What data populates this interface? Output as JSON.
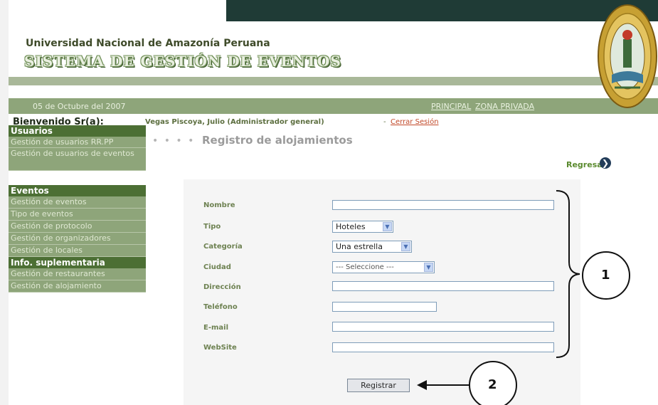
{
  "header": {
    "university": "Universidad Nacional de Amazonía Peruana",
    "system_title": "SISTEMA DE GESTIÓN DE EVENTOS",
    "date": "05 de Octubre del 2007",
    "nav_principal": "PRINCIPAL",
    "nav_private": "ZONA PRIVADA"
  },
  "welcome": {
    "greeting": "Bienvenido Sr(a):",
    "user": "Vegas Piscoya, Julio (Administrador general)",
    "separator": "-",
    "logout": "Cerrar Sesión"
  },
  "sidebar": {
    "sections": [
      {
        "title": "Usuarios",
        "items": [
          "Gestión de usuarios RR.PP",
          "Gestión de usuarios de eventos"
        ]
      },
      {
        "title": "Eventos",
        "items": [
          "Gestión de eventos",
          "Tipo de eventos",
          "Gestión de protocolo",
          "Gestión de organizadores",
          "Gestión de locales"
        ]
      },
      {
        "title": "Info. suplementaria",
        "items": [
          "Gestión de restaurantes",
          "Gestión de alojamiento"
        ]
      }
    ]
  },
  "main": {
    "dots": "• • • •",
    "title": "Registro de alojamientos",
    "back_label": "Regresar",
    "back_icon": "arrow-circle-right-icon"
  },
  "form": {
    "labels": {
      "nombre": "Nombre",
      "tipo": "Tipo",
      "categoria": "Categoría",
      "ciudad": "Ciudad",
      "direccion": "Dirección",
      "telefono": "Teléfono",
      "email": "E-mail",
      "website": "WebSite"
    },
    "values": {
      "nombre": "",
      "tipo": "Hoteles",
      "categoria": "Una estrella",
      "ciudad": "--- Seleccione ---",
      "direccion": "",
      "telefono": "",
      "email": "",
      "website": ""
    },
    "submit": "Registrar"
  },
  "annotations": {
    "callout_1": "1",
    "callout_2": "2"
  },
  "colors": {
    "header_dark": "#1f3b36",
    "menu_head": "#4c6f34",
    "menu_item": "#8ea57a",
    "label": "#6e8252"
  }
}
